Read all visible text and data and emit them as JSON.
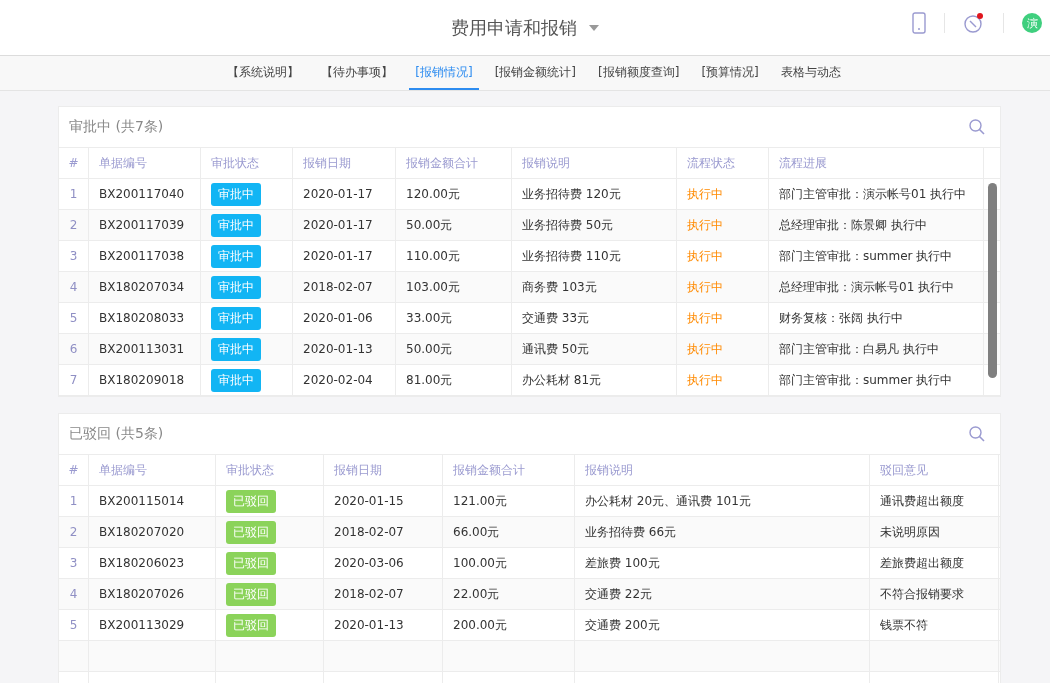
{
  "header": {
    "title": "费用申请和报销",
    "notification": true,
    "avatar": "演"
  },
  "tabs": [
    {
      "label": "【系统说明】",
      "selected": false
    },
    {
      "label": "【待办事项】",
      "selected": false
    },
    {
      "label": "[报销情况]",
      "selected": true
    },
    {
      "label": "[报销金额统计]",
      "selected": false
    },
    {
      "label": "[报销额度查询]",
      "selected": false
    },
    {
      "label": "[预算情况]",
      "selected": false
    },
    {
      "label": "表格与动态",
      "selected": false
    }
  ],
  "panels": [
    {
      "title": "审批中 (共7条)",
      "scrollbar": true,
      "columns": [
        "#",
        "单据编号",
        "审批状态",
        "报销日期",
        "报销金额合计",
        "报销说明",
        "流程状态",
        "流程进展"
      ],
      "rows": [
        [
          "1",
          "BX200117040",
          {
            "text": "审批中",
            "kind": "pending"
          },
          "2020-01-17",
          "120.00元",
          "业务招待费 120元",
          {
            "text": "执行中",
            "kind": "running"
          },
          "部门主管审批：演示帐号01 执行中"
        ],
        [
          "2",
          "BX200117039",
          {
            "text": "审批中",
            "kind": "pending"
          },
          "2020-01-17",
          "50.00元",
          "业务招待费 50元",
          {
            "text": "执行中",
            "kind": "running"
          },
          "总经理审批：陈景卿 执行中"
        ],
        [
          "3",
          "BX200117038",
          {
            "text": "审批中",
            "kind": "pending"
          },
          "2020-01-17",
          "110.00元",
          "业务招待费 110元",
          {
            "text": "执行中",
            "kind": "running"
          },
          "部门主管审批：summer 执行中"
        ],
        [
          "4",
          "BX180207034",
          {
            "text": "审批中",
            "kind": "pending"
          },
          "2018-02-07",
          "103.00元",
          "商务费 103元",
          {
            "text": "执行中",
            "kind": "running"
          },
          "总经理审批：演示帐号01 执行中"
        ],
        [
          "5",
          "BX180208033",
          {
            "text": "审批中",
            "kind": "pending"
          },
          "2020-01-06",
          "33.00元",
          "交通费 33元",
          {
            "text": "执行中",
            "kind": "running"
          },
          "财务复核：张阔 执行中"
        ],
        [
          "6",
          "BX200113031",
          {
            "text": "审批中",
            "kind": "pending"
          },
          "2020-01-13",
          "50.00元",
          "通讯费 50元",
          {
            "text": "执行中",
            "kind": "running"
          },
          "部门主管审批：白易凡 执行中"
        ],
        [
          "7",
          "BX180209018",
          {
            "text": "审批中",
            "kind": "pending"
          },
          "2020-02-04",
          "81.00元",
          "办公耗材 81元",
          {
            "text": "执行中",
            "kind": "running"
          },
          "部门主管审批：summer 执行中"
        ]
      ]
    },
    {
      "title": "已驳回 (共5条)",
      "scrollbar": false,
      "columns": [
        "#",
        "单据编号",
        "审批状态",
        "报销日期",
        "报销金额合计",
        "报销说明",
        "驳回意见"
      ],
      "rows": [
        [
          "1",
          "BX200115014",
          {
            "text": "已驳回",
            "kind": "rejected"
          },
          "2020-01-15",
          "121.00元",
          "办公耗材 20元、通讯费 101元",
          "通讯费超出额度"
        ],
        [
          "2",
          "BX180207020",
          {
            "text": "已驳回",
            "kind": "rejected"
          },
          "2018-02-07",
          "66.00元",
          "业务招待费 66元",
          "未说明原因"
        ],
        [
          "3",
          "BX180206023",
          {
            "text": "已驳回",
            "kind": "rejected"
          },
          "2020-03-06",
          "100.00元",
          "差旅费 100元",
          "差旅费超出额度"
        ],
        [
          "4",
          "BX180207026",
          {
            "text": "已驳回",
            "kind": "rejected"
          },
          "2018-02-07",
          "22.00元",
          "交通费 22元",
          "不符合报销要求"
        ],
        [
          "5",
          "BX200113029",
          {
            "text": "已驳回",
            "kind": "rejected"
          },
          "2020-01-13",
          "200.00元",
          "交通费 200元",
          "钱票不符"
        ]
      ]
    }
  ]
}
